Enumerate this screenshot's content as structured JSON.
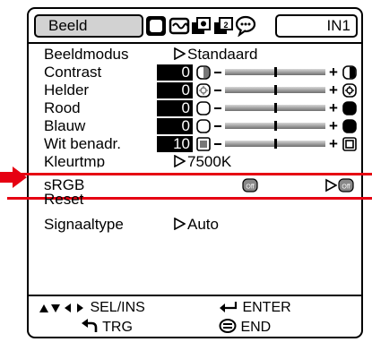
{
  "menu": {
    "tab_label": "Beeld",
    "input": "IN1"
  },
  "rows": [
    {
      "label": "Beeldmodus",
      "value": "Standaard"
    },
    {
      "label": "Contrast",
      "number": "0",
      "level": 0.5
    },
    {
      "label": "Helder",
      "number": "0",
      "level": 0.5
    },
    {
      "label": "Rood",
      "number": "0",
      "level": 0.5
    },
    {
      "label": "Blauw",
      "number": "0",
      "level": 0.5
    },
    {
      "label": "Wit benadr.",
      "number": "10",
      "level": 0.5
    },
    {
      "label": "Kleurtmp",
      "value": "7500K"
    },
    {
      "label": "sRGB"
    },
    {
      "label": "Reset"
    },
    {
      "label": "Signaaltype",
      "value": "Auto"
    }
  ],
  "footer": {
    "sel": "SEL/INS",
    "enter": "ENTER",
    "trg": "TRG",
    "end": "END"
  },
  "colors": {
    "highlight": "#e60012",
    "tab_fill": "#d2d2d2"
  }
}
